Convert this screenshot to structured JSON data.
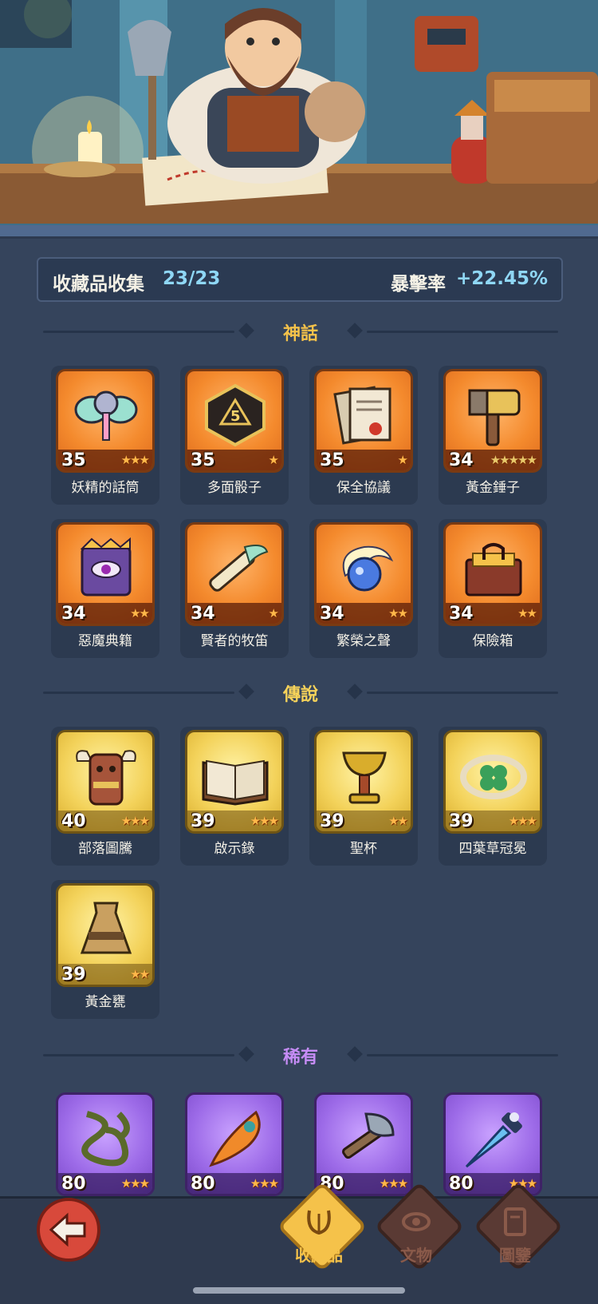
{
  "header": {
    "collection_label": "收藏品收集",
    "collection_count": "23/23",
    "crit_label": "暴擊率",
    "crit_value": "+22.45%"
  },
  "sections": {
    "mythic": {
      "title": "神話",
      "color": "#f5c24a"
    },
    "legendary": {
      "title": "傳說",
      "color": "#f7d35a"
    },
    "rare": {
      "title": "稀有",
      "color": "#c58cf5"
    }
  },
  "mythic_items": [
    {
      "name": "妖精的話筒",
      "level": "35",
      "stars": "★★★",
      "icon": "fairy-microphone-icon"
    },
    {
      "name": "多面骰子",
      "level": "35",
      "stars": "★",
      "icon": "polyhedral-dice-icon"
    },
    {
      "name": "保全協議",
      "level": "35",
      "stars": "★",
      "icon": "security-agreement-icon"
    },
    {
      "name": "黃金錘子",
      "level": "34",
      "stars": "★★★★★",
      "icon": "golden-hammer-icon"
    },
    {
      "name": "惡魔典籍",
      "level": "34",
      "stars": "★★",
      "icon": "demon-tome-icon"
    },
    {
      "name": "賢者的牧笛",
      "level": "34",
      "stars": "★",
      "icon": "sage-flute-icon"
    },
    {
      "name": "繁榮之聲",
      "level": "34",
      "stars": "★★",
      "icon": "prosperity-voice-icon"
    },
    {
      "name": "保險箱",
      "level": "34",
      "stars": "★★",
      "icon": "safe-box-icon"
    }
  ],
  "legendary_items": [
    {
      "name": "部落圖騰",
      "level": "40",
      "stars": "★★★",
      "icon": "tribal-totem-icon"
    },
    {
      "name": "啟示錄",
      "level": "39",
      "stars": "★★★",
      "icon": "revelation-book-icon"
    },
    {
      "name": "聖杯",
      "level": "39",
      "stars": "★★",
      "icon": "holy-grail-icon"
    },
    {
      "name": "四葉草冠冕",
      "level": "39",
      "stars": "★★★",
      "icon": "clover-crown-icon"
    },
    {
      "name": "黃金甕",
      "level": "39",
      "stars": "★★",
      "icon": "golden-urn-icon"
    }
  ],
  "rare_items": [
    {
      "level": "80",
      "stars": "★★★",
      "icon": "thorn-vine-icon"
    },
    {
      "level": "80",
      "stars": "★★★",
      "icon": "phoenix-feather-icon"
    },
    {
      "level": "80",
      "stars": "★★★",
      "icon": "stone-axe-icon"
    },
    {
      "level": "80",
      "stars": "★★★",
      "icon": "ice-dagger-icon"
    }
  ],
  "nav": {
    "back_icon": "back-arrow-icon",
    "tab_collectibles": "收藏品",
    "tab_artifacts": "文物",
    "tab_codex": "圖鑒",
    "active_color": "#f5c24a",
    "inactive_color": "#8a5a4a"
  }
}
